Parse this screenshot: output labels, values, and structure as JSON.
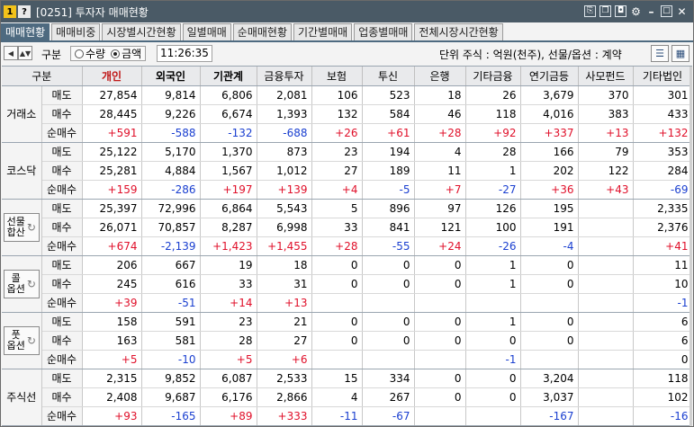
{
  "window": {
    "icon1": "1",
    "icon2": "?",
    "title": "[0251] 투자자 매매현황",
    "controls": [
      "link-icon",
      "copy-icon",
      "camera-icon",
      "gear-icon",
      "minimize-icon",
      "maximize-icon",
      "close-icon"
    ]
  },
  "tabs": [
    {
      "label": "매매현황",
      "active": true
    },
    {
      "label": "매매비중"
    },
    {
      "label": "시장별시간현황"
    },
    {
      "label": "일별매매"
    },
    {
      "label": "순매매현황"
    },
    {
      "label": "기간별매매"
    },
    {
      "label": "업종별매매"
    },
    {
      "label": "전체시장시간현황"
    }
  ],
  "toolbar": {
    "type_label": "구분",
    "radio_qty": "수량",
    "radio_amount": "금액",
    "selected": "금액",
    "time": "11:26:35",
    "unit_text": "단위 주식 : 억원(천주), 선물/옵션 : 계약"
  },
  "table": {
    "headers": [
      "구분",
      "",
      "개인",
      "외국인",
      "기관계",
      "금융투자",
      "보험",
      "투신",
      "은행",
      "기타금융",
      "연기금등",
      "사모펀드",
      "기타법인"
    ],
    "row_labels": [
      "매도",
      "매수",
      "순매수"
    ],
    "groups": [
      {
        "name": "거래소",
        "button": false,
        "rows": [
          [
            "27,854",
            "9,814",
            "6,806",
            "2,081",
            "106",
            "523",
            "18",
            "26",
            "3,679",
            "370",
            "301"
          ],
          [
            "28,445",
            "9,226",
            "6,674",
            "1,393",
            "132",
            "584",
            "46",
            "118",
            "4,016",
            "383",
            "433"
          ],
          [
            "+591",
            "-588",
            "-132",
            "-688",
            "+26",
            "+61",
            "+28",
            "+92",
            "+337",
            "+13",
            "+132"
          ]
        ]
      },
      {
        "name": "코스닥",
        "button": false,
        "rows": [
          [
            "25,122",
            "5,170",
            "1,370",
            "873",
            "23",
            "194",
            "4",
            "28",
            "166",
            "79",
            "353"
          ],
          [
            "25,281",
            "4,884",
            "1,567",
            "1,012",
            "27",
            "189",
            "11",
            "1",
            "202",
            "122",
            "284"
          ],
          [
            "+159",
            "-286",
            "+197",
            "+139",
            "+4",
            "-5",
            "+7",
            "-27",
            "+36",
            "+43",
            "-69"
          ]
        ]
      },
      {
        "name": "선물\n합산",
        "button": true,
        "rows": [
          [
            "25,397",
            "72,996",
            "6,864",
            "5,543",
            "5",
            "896",
            "97",
            "126",
            "195",
            "",
            "2,335"
          ],
          [
            "26,071",
            "70,857",
            "8,287",
            "6,998",
            "33",
            "841",
            "121",
            "100",
            "191",
            "",
            "2,376"
          ],
          [
            "+674",
            "-2,139",
            "+1,423",
            "+1,455",
            "+28",
            "-55",
            "+24",
            "-26",
            "-4",
            "",
            "+41"
          ]
        ]
      },
      {
        "name": "콜\n옵션",
        "button": true,
        "rows": [
          [
            "206",
            "667",
            "19",
            "18",
            "0",
            "0",
            "0",
            "1",
            "0",
            "",
            "11"
          ],
          [
            "245",
            "616",
            "33",
            "31",
            "0",
            "0",
            "0",
            "1",
            "0",
            "",
            "10"
          ],
          [
            "+39",
            "-51",
            "+14",
            "+13",
            "",
            "",
            "",
            "",
            "",
            "",
            "-1"
          ]
        ]
      },
      {
        "name": "풋\n옵션",
        "button": true,
        "rows": [
          [
            "158",
            "591",
            "23",
            "21",
            "0",
            "0",
            "0",
            "1",
            "0",
            "",
            "6"
          ],
          [
            "163",
            "581",
            "28",
            "27",
            "0",
            "0",
            "0",
            "0",
            "0",
            "",
            "6"
          ],
          [
            "+5",
            "-10",
            "+5",
            "+6",
            "",
            "",
            "",
            "-1",
            "",
            "",
            "0"
          ]
        ]
      },
      {
        "name": "주식선",
        "button": false,
        "rows": [
          [
            "2,315",
            "9,852",
            "6,087",
            "2,533",
            "15",
            "334",
            "0",
            "0",
            "3,204",
            "",
            "118"
          ],
          [
            "2,408",
            "9,687",
            "6,176",
            "2,866",
            "4",
            "267",
            "0",
            "0",
            "3,037",
            "",
            "102"
          ],
          [
            "+93",
            "-165",
            "+89",
            "+333",
            "-11",
            "-67",
            "",
            "",
            "-167",
            "",
            "-16"
          ]
        ]
      }
    ]
  },
  "colors": {
    "positive": "#e0102a",
    "negative": "#1a3fd0",
    "accent": "#4e6a80"
  }
}
